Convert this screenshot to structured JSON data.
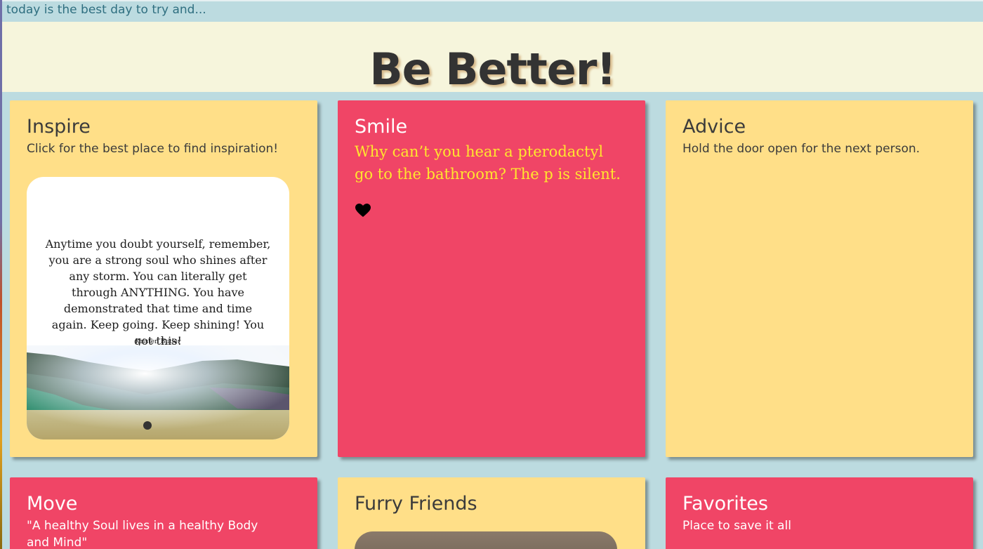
{
  "tagline": "today is the best day to try and...",
  "title": "Be Better!",
  "cards": [
    {
      "title": "Inspire",
      "subtitle": "Click for the best place to find inspiration!",
      "image": {
        "quote": "Anytime you doubt yourself, remember, you are a strong soul who shines after any storm. You can literally get through ANYTHING. You have demonstrated that time and time again. Keep going. Keep shining! You got this!",
        "author": "Kristen Butler"
      }
    },
    {
      "title": "Smile",
      "joke": "Why can’t you hear a pterodactyl go to the bathroom? The p is silent.",
      "icon": "heart-icon"
    },
    {
      "title": "Advice",
      "subtitle": "Hold the door open for the next person."
    },
    {
      "title": "Move",
      "subtitle": "\"A healthy Soul lives in a healthy Body and Mind\""
    },
    {
      "title": "Furry Friends"
    },
    {
      "title": "Favorites",
      "subtitle": "Place to save it all"
    }
  ],
  "colors": {
    "background": "#bcdbe0",
    "header": "#f6f5dc",
    "card_yellow": "#ffdf88",
    "card_pink": "#f04566",
    "joke_text": "#ffe62e"
  }
}
